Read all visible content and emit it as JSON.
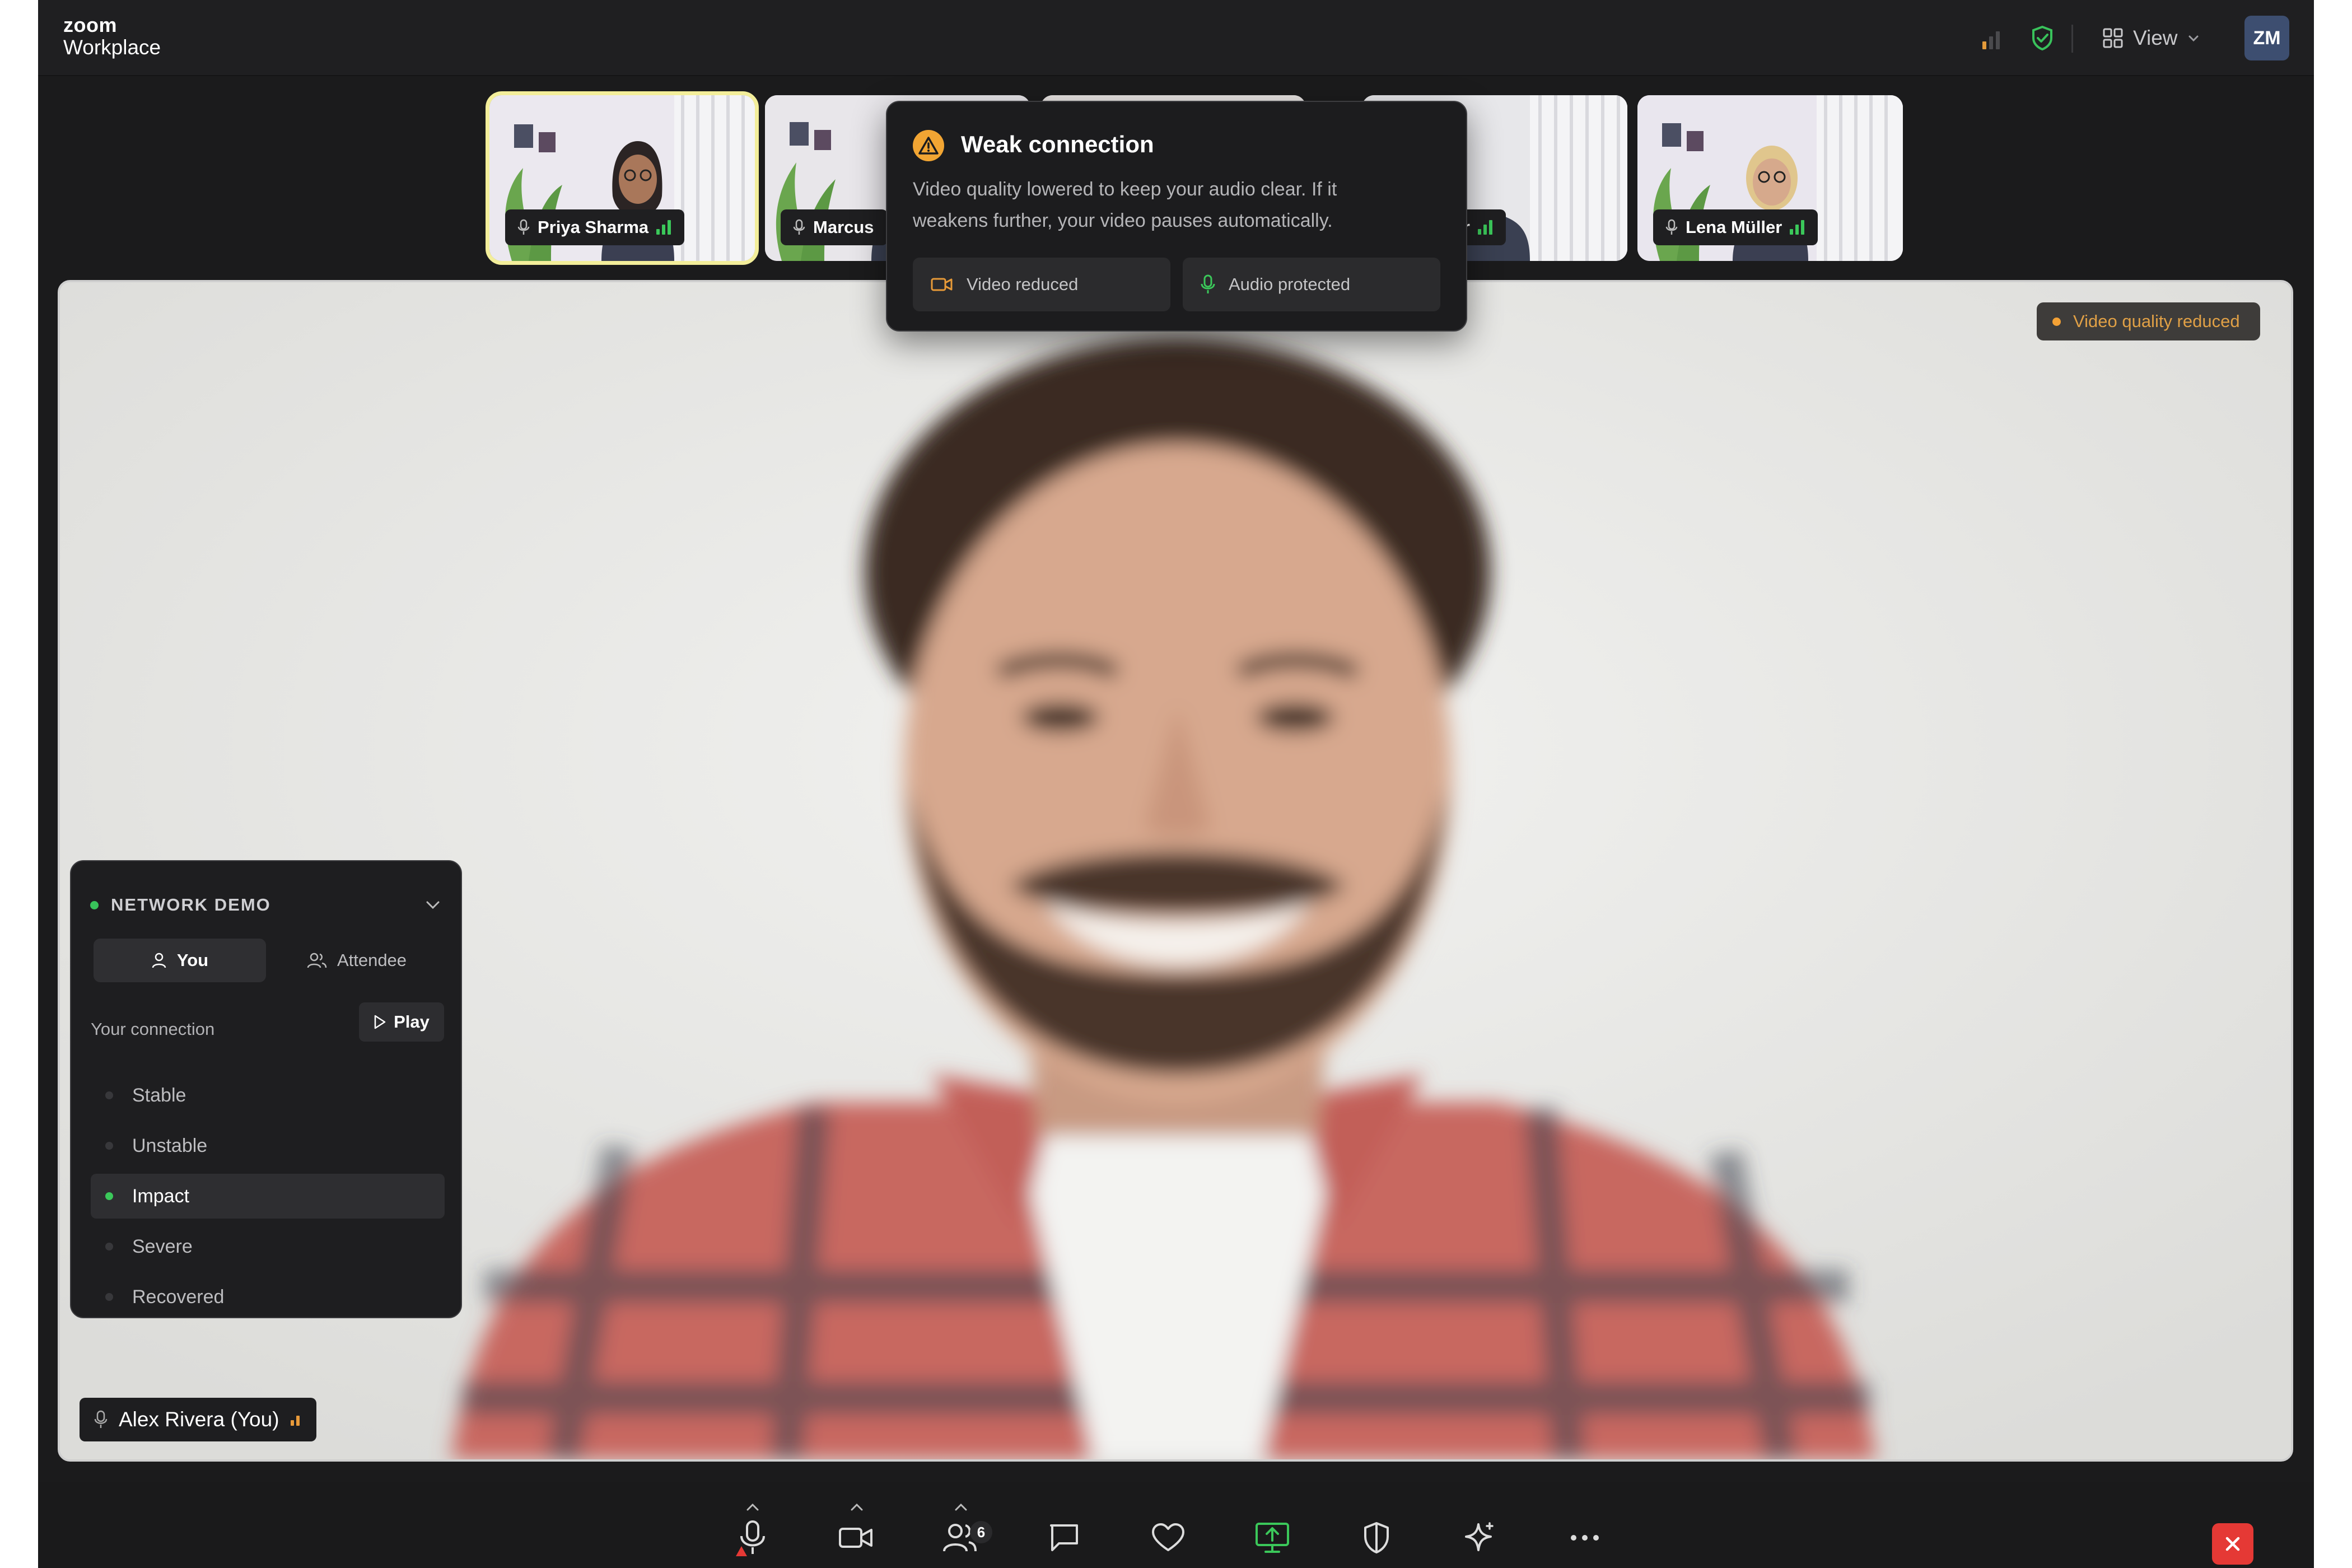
{
  "brand": {
    "line1": "zoom",
    "line2": "Workplace"
  },
  "topbar": {
    "view_label": "View",
    "avatar_initials": "ZM"
  },
  "thumbnails": [
    {
      "name": "Priya Sharma",
      "active": true
    },
    {
      "name": "Marcus",
      "active": false
    },
    {
      "name": "",
      "active": false
    },
    {
      "name": "or",
      "active": false
    },
    {
      "name": "Lena Müller",
      "active": false
    }
  ],
  "popover": {
    "title": "Weak connection",
    "body": "Video quality lowered to keep your audio clear. If it weakens further, your video pauses automatically.",
    "chip_video": "Video reduced",
    "chip_audio": "Audio protected"
  },
  "main_video": {
    "badge": "Video quality reduced",
    "you_label": "Alex Rivera (You)"
  },
  "network_panel": {
    "title": "NETWORK DEMO",
    "tab_you": "You",
    "tab_attendee": "Attendee",
    "connection_label": "Your connection",
    "play_label": "Play",
    "options": [
      "Stable",
      "Unstable",
      "Impact",
      "Severe",
      "Recovered"
    ],
    "selected": "Impact"
  },
  "toolbar": {
    "participants_count": "6"
  },
  "colors": {
    "accent_green": "#3bc85a",
    "warning_orange": "#f2a533",
    "end_red": "#e53935",
    "active_outline": "#f3ee9a"
  }
}
